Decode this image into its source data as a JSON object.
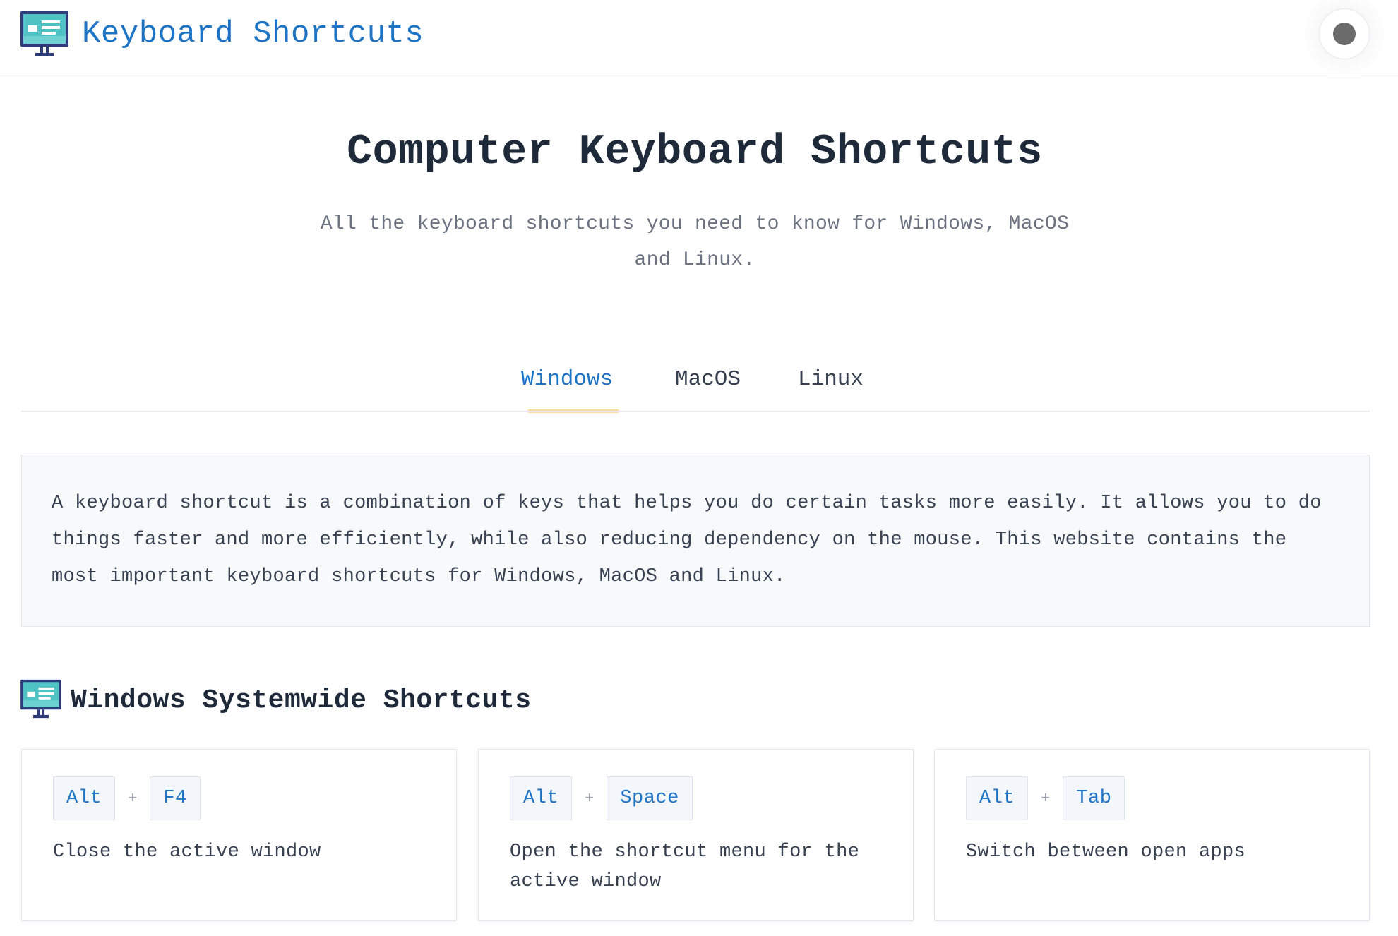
{
  "header": {
    "brand": "Keyboard Shortcuts",
    "logo_icon": "monitor-icon",
    "theme_toggle_icon": "theme-toggle-icon"
  },
  "hero": {
    "title": "Computer Keyboard Shortcuts",
    "subtitle": "All the keyboard shortcuts you need to know for Windows, MacOS and Linux."
  },
  "tabs": [
    {
      "label": "Windows",
      "active": true
    },
    {
      "label": "MacOS",
      "active": false
    },
    {
      "label": "Linux",
      "active": false
    }
  ],
  "intro": {
    "text": "A keyboard shortcut is a combination of keys that helps you do certain tasks more easily. It allows you to do things faster and more efficiently, while also reducing dependency on the mouse. This website contains the most important keyboard shortcuts for Windows, MacOS and Linux."
  },
  "section": {
    "title": "Windows Systemwide Shortcuts",
    "icon": "monitor-icon"
  },
  "shortcuts": [
    {
      "keys": [
        "Alt",
        "F4"
      ],
      "description": "Close the active window"
    },
    {
      "keys": [
        "Alt",
        "Space"
      ],
      "description": "Open the shortcut menu for the active window"
    },
    {
      "keys": [
        "Alt",
        "Tab"
      ],
      "description": "Switch between open apps"
    }
  ],
  "colors": {
    "accent": "#1d74c5",
    "tab_underline": "#f7dea0",
    "intro_bg": "#f8f9fb",
    "key_bg": "#f3f6fa"
  }
}
